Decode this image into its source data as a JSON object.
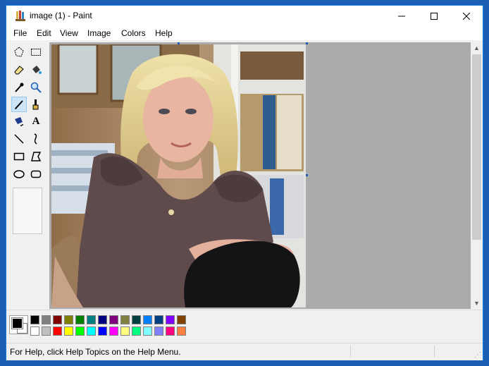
{
  "window": {
    "title": "image (1) - Paint"
  },
  "menu": [
    "File",
    "Edit",
    "View",
    "Image",
    "Colors",
    "Help"
  ],
  "tools": [
    {
      "name": "free-form-select-tool",
      "icon": "free-form-select-icon"
    },
    {
      "name": "select-tool",
      "icon": "rectangle-select-icon"
    },
    {
      "name": "eraser-tool",
      "icon": "eraser-icon"
    },
    {
      "name": "fill-tool",
      "icon": "fill-bucket-icon"
    },
    {
      "name": "pick-color-tool",
      "icon": "eyedropper-icon"
    },
    {
      "name": "magnifier-tool",
      "icon": "magnifier-icon"
    },
    {
      "name": "pencil-tool",
      "icon": "pencil-icon",
      "selected": true
    },
    {
      "name": "brush-tool",
      "icon": "brush-icon"
    },
    {
      "name": "airbrush-tool",
      "icon": "airbrush-icon"
    },
    {
      "name": "text-tool",
      "icon": "text-icon",
      "glyph": "A"
    },
    {
      "name": "line-tool",
      "icon": "line-icon"
    },
    {
      "name": "curve-tool",
      "icon": "curve-icon"
    },
    {
      "name": "rectangle-tool",
      "icon": "rectangle-icon"
    },
    {
      "name": "polygon-tool",
      "icon": "polygon-icon"
    },
    {
      "name": "ellipse-tool",
      "icon": "ellipse-icon"
    },
    {
      "name": "rounded-rectangle-tool",
      "icon": "rounded-rectangle-icon"
    }
  ],
  "palette": {
    "foreground": "#000000",
    "background": "#ffffff",
    "row1": [
      "#000000",
      "#808080",
      "#800000",
      "#808000",
      "#008000",
      "#008080",
      "#000080",
      "#800080",
      "#808040",
      "#004040",
      "#0080ff",
      "#004080",
      "#8000ff",
      "#804000"
    ],
    "row2": [
      "#ffffff",
      "#c0c0c0",
      "#ff0000",
      "#ffff00",
      "#00ff00",
      "#00ffff",
      "#0000ff",
      "#ff00ff",
      "#ffff80",
      "#00ff80",
      "#80ffff",
      "#8080ff",
      "#ff0080",
      "#ff8040"
    ]
  },
  "status": {
    "help_text": "For Help, click Help Topics on the Help Menu."
  }
}
